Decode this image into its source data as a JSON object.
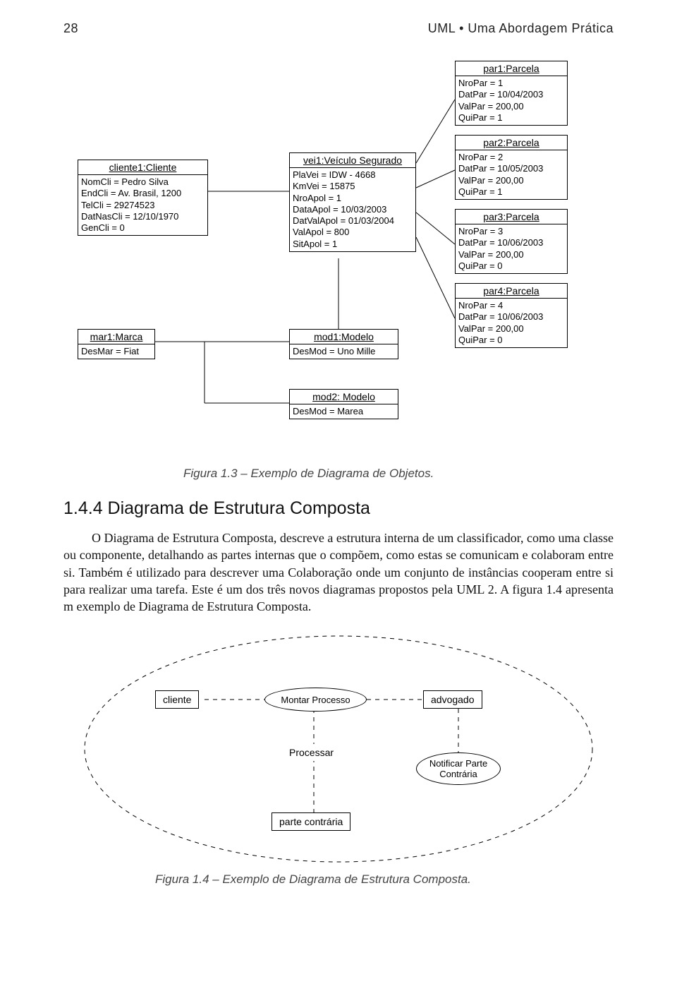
{
  "header": {
    "page_number": "28",
    "running_title": "UML • Uma Abordagem Prática"
  },
  "diagram1": {
    "cliente": {
      "title": "cliente1:Cliente",
      "lines": [
        "NomCli = Pedro Silva",
        "EndCli = Av. Brasil, 1200",
        "TelCli = 29274523",
        "DatNasCli = 12/10/1970",
        "GenCli = 0"
      ]
    },
    "veiculo": {
      "title": "vei1:Veículo Segurado",
      "lines": [
        "PlaVei = IDW - 4668",
        "KmVei = 15875",
        "NroApol = 1",
        "DataApol = 10/03/2003",
        "DatValApol = 01/03/2004",
        "ValApol = 800",
        "SitApol = 1"
      ]
    },
    "par1": {
      "title": "par1:Parcela",
      "lines": [
        "NroPar = 1",
        "DatPar = 10/04/2003",
        "ValPar = 200,00",
        "QuiPar = 1"
      ]
    },
    "par2": {
      "title": "par2:Parcela",
      "lines": [
        "NroPar = 2",
        "DatPar = 10/05/2003",
        "ValPar = 200,00",
        "QuiPar = 1"
      ]
    },
    "par3": {
      "title": "par3:Parcela",
      "lines": [
        "NroPar = 3",
        "DatPar = 10/06/2003",
        "ValPar = 200,00",
        "QuiPar = 0"
      ]
    },
    "par4": {
      "title": "par4:Parcela",
      "lines": [
        "NroPar = 4",
        "DatPar = 10/06/2003",
        "ValPar = 200,00",
        "QuiPar = 0"
      ]
    },
    "mar1": {
      "title": "mar1:Marca",
      "lines": [
        "DesMar = Fiat"
      ]
    },
    "mod1": {
      "title": "mod1:Modelo",
      "lines": [
        "DesMod = Uno Mille"
      ]
    },
    "mod2": {
      "title": "mod2: Modelo",
      "lines": [
        "DesMod = Marea"
      ]
    }
  },
  "caption1": "Figura 1.3 – Exemplo de Diagrama de Objetos.",
  "section": {
    "heading": "1.4.4 Diagrama de Estrutura Composta",
    "paragraph": "O Diagrama de Estrutura Composta, descreve a estrutura interna de um classificador, como uma classe ou componente, detalhando as partes internas que o compõem, como estas se comunicam e colaboram entre si. Também é utilizado para descrever uma Colaboração onde um conjunto de instâncias cooperam entre si para realizar uma tarefa. Este é um dos três novos diagramas propostos pela UML 2. A figura 1.4 apresenta m exemplo de Diagrama de Estrutura Composta."
  },
  "diagram2": {
    "cliente": "cliente",
    "montar": "Montar Processo",
    "advogado": "advogado",
    "processar": "Processar",
    "notificar": "Notificar Parte Contrária",
    "parte": "parte contrária"
  },
  "caption2": "Figura 1.4 – Exemplo de Diagrama de Estrutura Composta."
}
